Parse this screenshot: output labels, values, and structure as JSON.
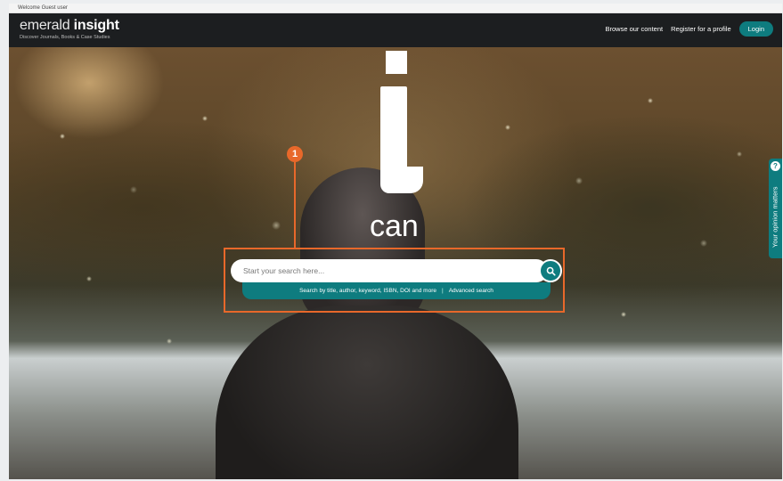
{
  "top_bar": {
    "welcome_text": "Welcome Guest user"
  },
  "header": {
    "logo_light": "emerald",
    "logo_bold": "insight",
    "logo_tagline": "Discover Journals, Books & Case Studies",
    "nav": {
      "browse": "Browse our content",
      "register": "Register for a profile",
      "login": "Login"
    }
  },
  "hero": {
    "headline_letter": "i",
    "headline_word": "can",
    "callout_number": "1",
    "search": {
      "placeholder": "Start your search here...",
      "value": "",
      "hint": "Search by title, author, keyword, ISBN, DOI and more",
      "separator": "|",
      "advanced": "Advanced search"
    }
  },
  "feedback_tab": {
    "label": "Your opinion matters",
    "badge": "?"
  },
  "colors": {
    "accent": "#0e7c7f",
    "header_bg": "#1c1e20",
    "callout": "#e8682a"
  },
  "icons": {
    "search": "search-icon"
  }
}
